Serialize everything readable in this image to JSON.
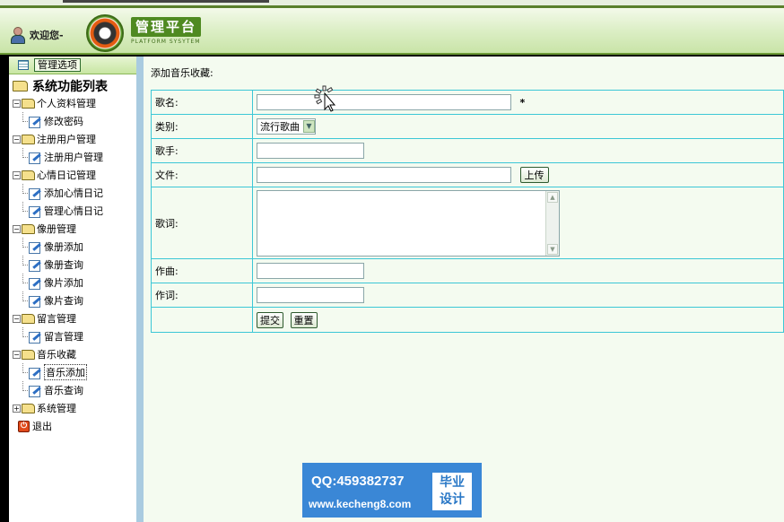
{
  "header": {
    "welcome": "欢迎您-",
    "logo_title": "管理平台",
    "logo_subtitle": "PLATFORM SYSYTEM"
  },
  "sidebar": {
    "options_button": "管理选项",
    "root": "系统功能列表",
    "groups": [
      {
        "label": "个人资料管理",
        "items": [
          "修改密码"
        ]
      },
      {
        "label": "注册用户管理",
        "items": [
          "注册用户管理"
        ]
      },
      {
        "label": "心情日记管理",
        "items": [
          "添加心情日记",
          "管理心情日记"
        ]
      },
      {
        "label": "像册管理",
        "items": [
          "像册添加",
          "像册查询",
          "像片添加",
          "像片查询"
        ]
      },
      {
        "label": "留言管理",
        "items": [
          "留言管理"
        ]
      },
      {
        "label": "音乐收藏",
        "items": [
          "音乐添加",
          "音乐查询"
        ]
      },
      {
        "label": "系统管理",
        "items": []
      }
    ],
    "exit": "退出"
  },
  "main": {
    "title": "添加音乐收藏:",
    "form": {
      "song_label": "歌名:",
      "song_value": "",
      "required_mark": "*",
      "category_label": "类别:",
      "category_value": "流行歌曲",
      "singer_label": "歌手:",
      "singer_value": "",
      "file_label": "文件:",
      "file_value": "",
      "upload_button": "上传",
      "lyrics_label": "歌词:",
      "lyrics_value": "",
      "composer_label": "作曲:",
      "composer_value": "",
      "lyricist_label": "作词:",
      "lyricist_value": "",
      "submit_button": "提交",
      "reset_button": "重置"
    }
  },
  "banner": {
    "qq": "QQ:459382737",
    "site": "www.kecheng8.com",
    "tag_line1": "毕业",
    "tag_line2": "设计"
  },
  "colors": {
    "accent_green": "#4f8a21",
    "table_border": "#3cc7d6",
    "banner_blue": "#3a87d6"
  }
}
